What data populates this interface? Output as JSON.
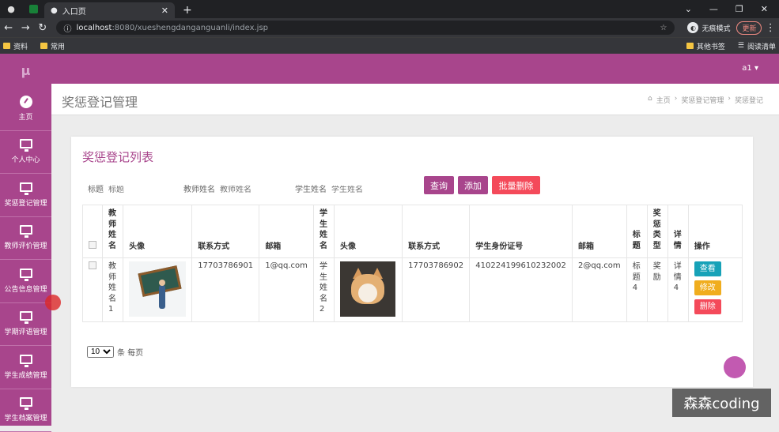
{
  "browser": {
    "tab_title": "入口页",
    "url_host": "localhost",
    "url_path": ":8080/xueshengdanganguanli/index.jsp",
    "incognito_label": "无痕模式",
    "update_label": "更新",
    "bookmarks": [
      "资料",
      "常用"
    ],
    "bookmarks_right": [
      "其他书签",
      "阅读清单"
    ]
  },
  "app": {
    "logo": "μ",
    "user": "a1 ▾",
    "accent": "#a8458c"
  },
  "sidebar": {
    "items": [
      {
        "label": "主页",
        "icon": "dashboard-icon"
      },
      {
        "label": "个人中心",
        "icon": "monitor-icon"
      },
      {
        "label": "奖惩登记管理",
        "icon": "monitor-icon"
      },
      {
        "label": "教师评价管理",
        "icon": "monitor-icon"
      },
      {
        "label": "公告信息管理",
        "icon": "monitor-icon"
      },
      {
        "label": "学期评语管理",
        "icon": "monitor-icon"
      },
      {
        "label": "学生成绩管理",
        "icon": "monitor-icon"
      },
      {
        "label": "学生档案管理",
        "icon": "monitor-icon"
      }
    ]
  },
  "header": {
    "title": "奖惩登记管理",
    "breadcrumb": [
      "主页",
      "奖惩登记管理",
      "奖惩登记"
    ]
  },
  "list": {
    "title": "奖惩登记列表",
    "filters": [
      {
        "label": "标题",
        "placeholder": "标题"
      },
      {
        "label": "教师姓名",
        "placeholder": "教师姓名"
      },
      {
        "label": "学生姓名",
        "placeholder": "学生姓名"
      }
    ],
    "buttons": {
      "search": "查询",
      "add": "添加",
      "batch_delete": "批量删除"
    },
    "columns": [
      "教师姓名",
      "头像",
      "联系方式",
      "邮箱",
      "学生姓名",
      "头像",
      "联系方式",
      "学生身份证号",
      "邮箱",
      "标题",
      "奖惩类型",
      "详情",
      "操作"
    ],
    "rows": [
      {
        "teacher_name": "教师姓名1",
        "teacher_phone": "17703786901",
        "teacher_email": "1@qq.com",
        "student_name": "学生姓名2",
        "student_phone": "17703786902",
        "student_id": "410224199610232002",
        "student_email": "2@qq.com",
        "title": "标题4",
        "type": "奖励",
        "detail": "详情4"
      }
    ],
    "row_actions": {
      "view": "查看",
      "edit": "修改",
      "delete": "删除"
    },
    "pager": {
      "size": "10",
      "suffix": "条 每页"
    }
  },
  "watermark": "森森coding"
}
